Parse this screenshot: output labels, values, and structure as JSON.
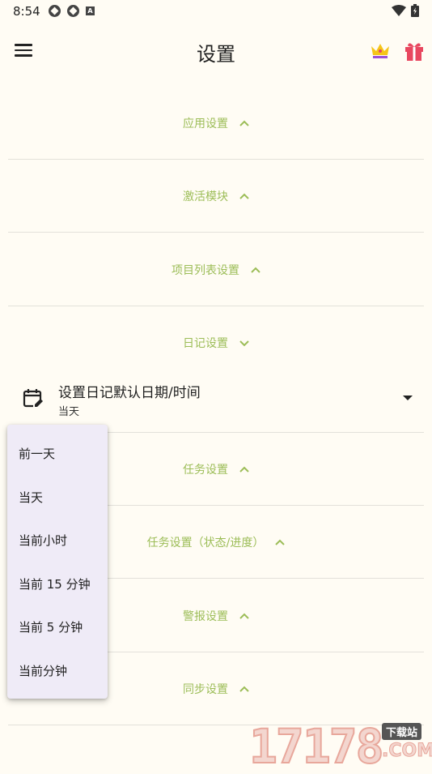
{
  "status_bar": {
    "time": "8:54",
    "left_icons": [
      "app-notification-icon",
      "app-notification-icon",
      "a-letter-icon"
    ],
    "right_icons": [
      "wifi-icon",
      "battery-icon"
    ]
  },
  "app_bar": {
    "title": "设置",
    "menu_icon": "hamburger-menu-icon",
    "crown_icon": "crown-icon",
    "gift_icon": "gift-icon"
  },
  "colors": {
    "background": "#fffcf4",
    "accent": "#9cbd57",
    "menu_bg": "#efebf7",
    "crown": "#f5c518",
    "crown_base": "#9c4fd6",
    "gift": "#e8475f"
  },
  "sections": [
    {
      "label": "应用设置",
      "expanded": false
    },
    {
      "label": "激活模块",
      "expanded": false
    },
    {
      "label": "项目列表设置",
      "expanded": false
    },
    {
      "label": "日记设置",
      "expanded": true
    },
    {
      "label": "任务设置",
      "expanded": false
    },
    {
      "label": "任务设置（状态/进度）",
      "expanded": false
    },
    {
      "label": "警报设置",
      "expanded": false
    },
    {
      "label": "同步设置",
      "expanded": false
    }
  ],
  "diary_setting": {
    "title": "设置日记默认日期/时间",
    "value": "当天",
    "icon": "calendar-edit-icon"
  },
  "dropdown_options": [
    "前一天",
    "当天",
    "当前小时",
    "当前 15 分钟",
    "当前 5 分钟",
    "当前分钟"
  ],
  "watermark": {
    "digits": "17178",
    "tag": "下载站",
    "suffix": ".COM"
  }
}
